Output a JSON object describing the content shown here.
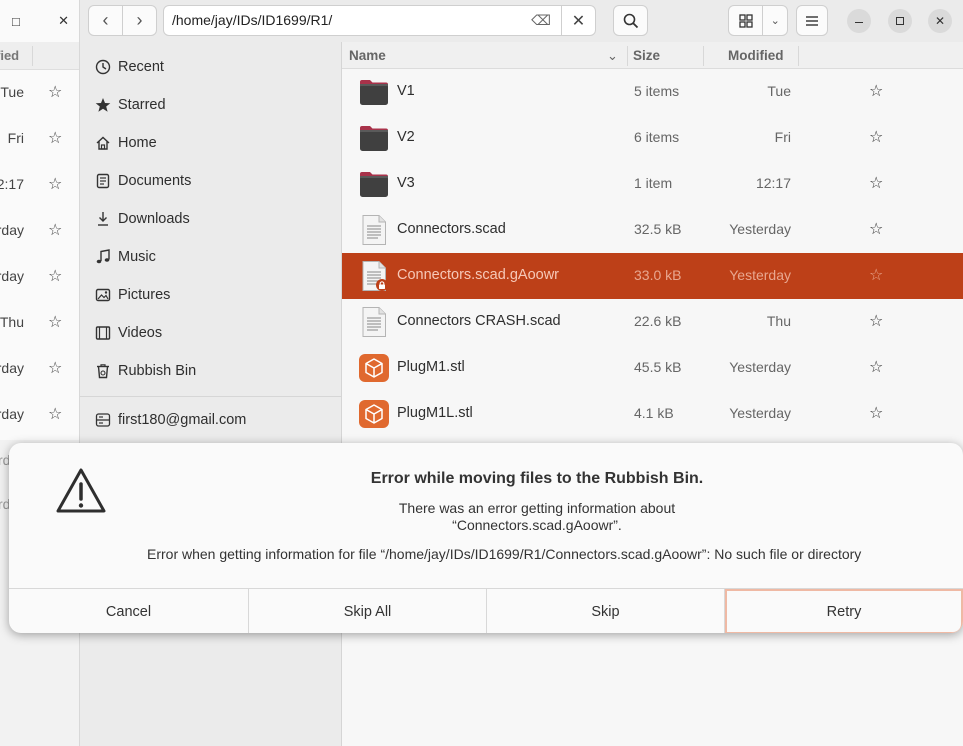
{
  "bg_window": {
    "header_partial": "o",
    "close_glyph": "✕",
    "col_partial": "fied",
    "rows": [
      {
        "time": "Tue"
      },
      {
        "time": "Fri"
      },
      {
        "time": "12:17"
      },
      {
        "time": "rday"
      },
      {
        "time": "rday"
      },
      {
        "time": "Thu"
      },
      {
        "time": "rday"
      },
      {
        "time": "rday"
      }
    ],
    "lower_partial_1": "rd",
    "lower_partial_2": "rd"
  },
  "header": {
    "back_glyph": "‹",
    "forward_glyph": "›",
    "path": "/home/jay/IDs/ID1699/R1/",
    "clear_glyph": "⌫",
    "close_path_glyph": "✕",
    "view_dropdown_glyph": "⌄",
    "minimize_glyph": "—",
    "maximize_glyph": "□",
    "close_glyph": "✕"
  },
  "sidebar": {
    "items": [
      {
        "label": "Recent",
        "icon": "clock-icon"
      },
      {
        "label": "Starred",
        "icon": "star-icon"
      },
      {
        "label": "Home",
        "icon": "home-icon"
      },
      {
        "label": "Documents",
        "icon": "document-icon"
      },
      {
        "label": "Downloads",
        "icon": "download-icon"
      },
      {
        "label": "Music",
        "icon": "music-icon"
      },
      {
        "label": "Pictures",
        "icon": "picture-icon"
      },
      {
        "label": "Videos",
        "icon": "video-icon"
      },
      {
        "label": "Rubbish Bin",
        "icon": "trash-icon"
      }
    ],
    "account": {
      "label": "first180@gmail.com",
      "icon": "drive-icon"
    }
  },
  "list": {
    "columns": {
      "name": "Name",
      "size": "Size",
      "modified": "Modified"
    },
    "rows": [
      {
        "name": "V1",
        "size": "5 items",
        "modified": "Tue",
        "type": "folder"
      },
      {
        "name": "V2",
        "size": "6 items",
        "modified": "Fri",
        "type": "folder"
      },
      {
        "name": "V3",
        "size": "1 item",
        "modified": "12:17",
        "type": "folder"
      },
      {
        "name": "Connectors.scad",
        "size": "32.5 kB",
        "modified": "Yesterday",
        "type": "text"
      },
      {
        "name": "Connectors.scad.gAoowr",
        "size": "33.0 kB",
        "modified": "Yesterday",
        "type": "text-locked",
        "selected": true
      },
      {
        "name": "Connectors CRASH.scad",
        "size": "22.6 kB",
        "modified": "Thu",
        "type": "text"
      },
      {
        "name": "PlugM1.stl",
        "size": "45.5 kB",
        "modified": "Yesterday",
        "type": "model"
      },
      {
        "name": "PlugM1L.stl",
        "size": "4.1 kB",
        "modified": "Yesterday",
        "type": "model"
      }
    ],
    "star_glyph": "☆"
  },
  "dialog": {
    "title": "Error while moving files to the Rubbish Bin.",
    "secondary_line1": "There was an error getting information about",
    "secondary_line2": "“Connectors.scad.gAoowr”.",
    "detail": "Error when getting information for file “/home/jay/IDs/ID1699/R1/Connectors.scad.gAoowr”: No such file or directory",
    "buttons": {
      "cancel": "Cancel",
      "skip_all": "Skip All",
      "skip": "Skip",
      "retry": "Retry"
    }
  },
  "colors": {
    "selection": "#bd4018",
    "folder_tab": "#a8324a",
    "model_icon": "#e0692f"
  }
}
